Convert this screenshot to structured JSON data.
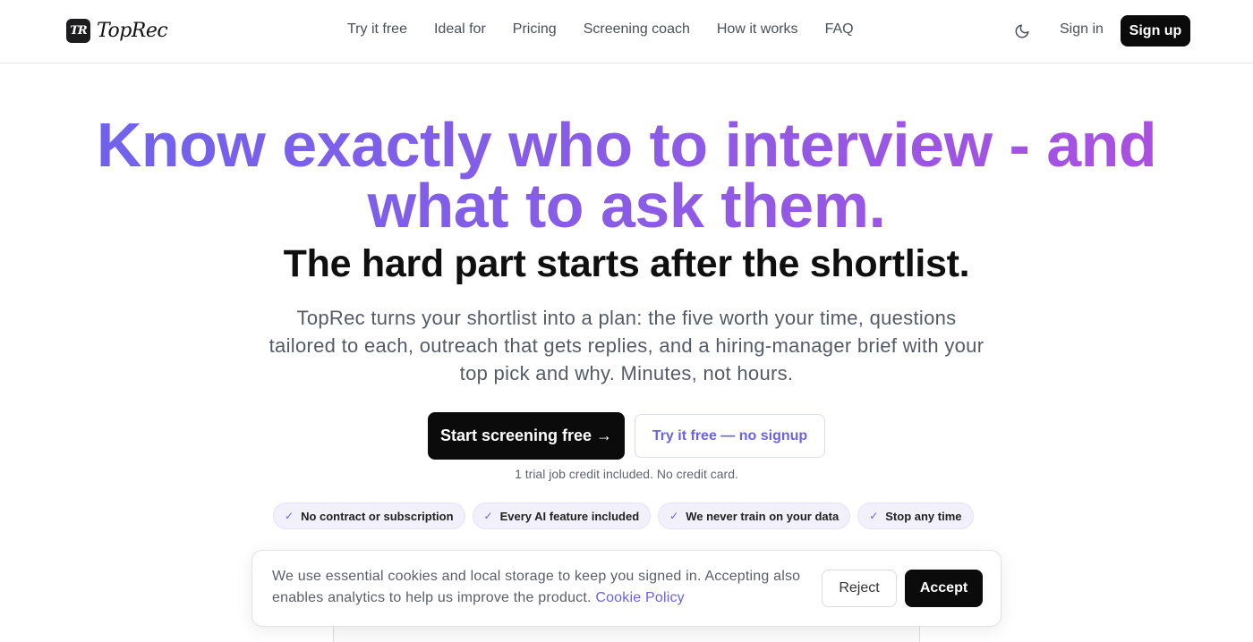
{
  "brand": {
    "mark": "TR",
    "name": "TopRec"
  },
  "nav": {
    "links": [
      "Try it free",
      "Ideal for",
      "Pricing",
      "Screening coach",
      "How it works",
      "FAQ"
    ],
    "theme_icon": "moon-icon",
    "sign_in": "Sign in",
    "sign_up": "Sign up"
  },
  "hero": {
    "headline_line1": "Know exactly who to interview - and",
    "headline_line2": "what to ask them.",
    "subhead": "The hard part starts after the shortlist.",
    "lead": "TopRec turns your shortlist into a plan: the five worth your time, questions tailored to each, outreach that gets replies, and a hiring-manager brief with your top pick and why. Minutes, not hours.",
    "cta_primary": "Start screening free →",
    "cta_secondary": "Try it free — no signup",
    "trial_note": "1 trial job credit included. No credit card.",
    "pills": [
      "No contract or subscription",
      "Every AI feature included",
      "We never train on your data",
      "Stop any time"
    ],
    "pill_icon": "check-icon"
  },
  "cookie": {
    "text": "We use essential cookies and local storage to keep you signed in. Accepting also enables analytics to help us improve the product.",
    "link": "Cookie Policy",
    "reject": "Reject",
    "accept": "Accept"
  },
  "colors": {
    "accent": "#6b63e6",
    "gradient_start": "#6c63ee",
    "gradient_end": "#b04ee0",
    "dark": "#0b0b0c"
  }
}
